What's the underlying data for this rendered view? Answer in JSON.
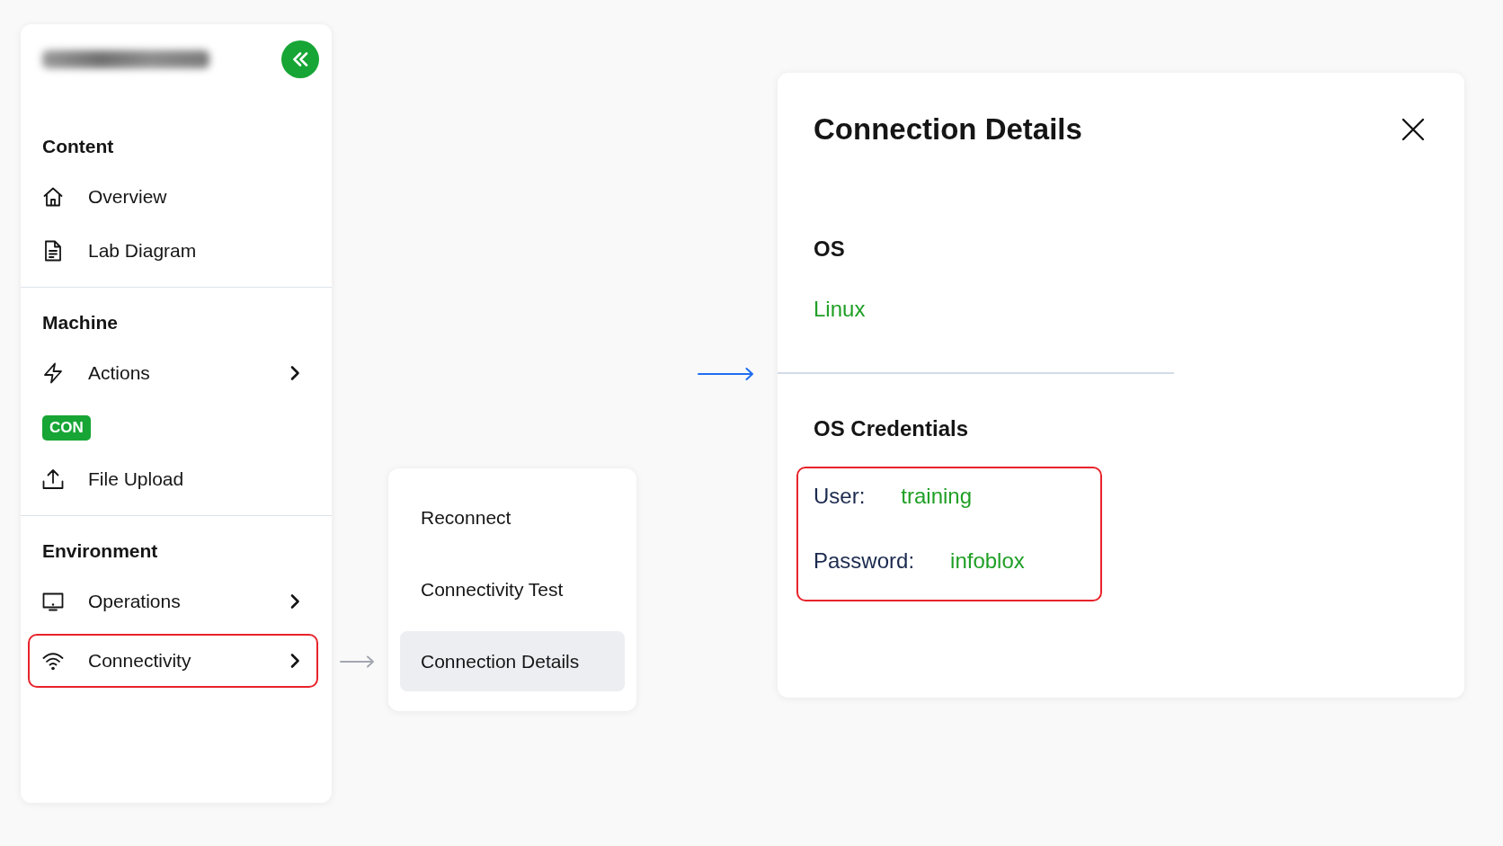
{
  "sidebar": {
    "sections": [
      {
        "heading": "Content",
        "items": [
          {
            "kind": "link",
            "label": "Overview",
            "has_submenu": false,
            "highlighted": false
          },
          {
            "kind": "link",
            "label": "Lab Diagram",
            "has_submenu": false,
            "highlighted": false
          }
        ]
      },
      {
        "heading": "Machine",
        "items": [
          {
            "kind": "link",
            "label": "Actions",
            "has_submenu": true,
            "highlighted": false
          },
          {
            "kind": "badge",
            "label": "CON"
          },
          {
            "kind": "link",
            "label": "File Upload",
            "has_submenu": false,
            "highlighted": false
          }
        ]
      },
      {
        "heading": "Environment",
        "items": [
          {
            "kind": "link",
            "label": "Operations",
            "has_submenu": true,
            "highlighted": false
          },
          {
            "kind": "link",
            "label": "Connectivity",
            "has_submenu": true,
            "highlighted": true
          }
        ]
      }
    ]
  },
  "submenu": {
    "items": [
      {
        "label": "Reconnect",
        "selected": false
      },
      {
        "label": "Connectivity Test",
        "selected": false
      },
      {
        "label": "Connection Details",
        "selected": true
      }
    ]
  },
  "details": {
    "title": "Connection Details",
    "os": {
      "heading": "OS",
      "value": "Linux"
    },
    "credentials": {
      "heading": "OS Credentials",
      "highlighted": true,
      "fields": [
        {
          "label": "User:",
          "value": "training"
        },
        {
          "label": "Password:",
          "value": "infoblox"
        }
      ]
    }
  }
}
